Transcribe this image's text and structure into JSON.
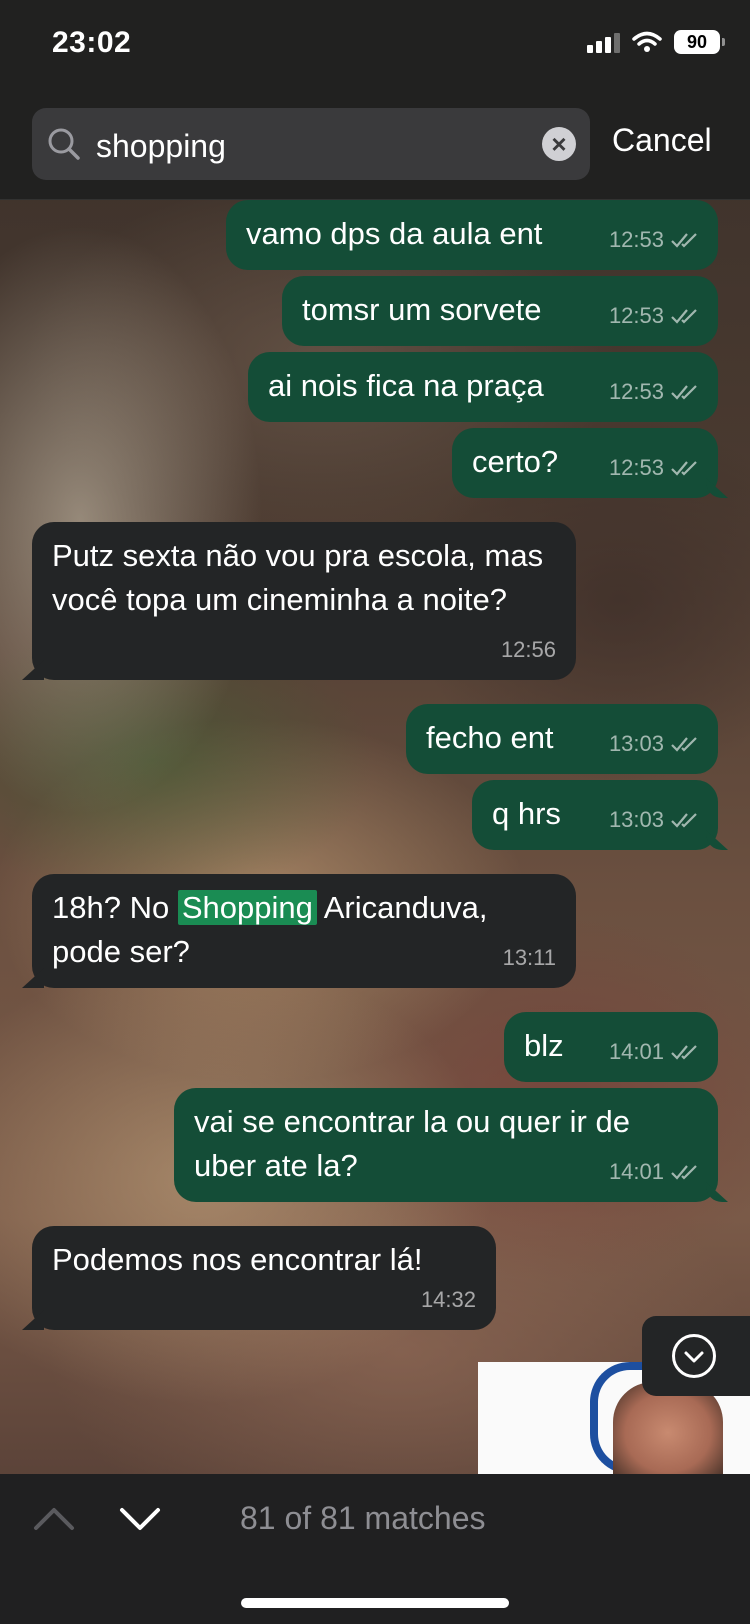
{
  "status_bar": {
    "time": "23:02",
    "battery": "90"
  },
  "search": {
    "query": "shopping",
    "cancel_label": "Cancel"
  },
  "messages": [
    {
      "dir": "out",
      "text": "vamo dps da aula ent",
      "time": "12:53"
    },
    {
      "dir": "out",
      "text": "tomsr um sorvete",
      "time": "12:53"
    },
    {
      "dir": "out",
      "text": "ai nois fica na praça",
      "time": "12:53"
    },
    {
      "dir": "out",
      "text": "certo?",
      "time": "12:53"
    },
    {
      "dir": "in",
      "text": "Putz sexta não vou pra escola, mas você topa um cineminha a noite?",
      "time": "12:56"
    },
    {
      "dir": "out",
      "text": "fecho ent",
      "time": "13:03"
    },
    {
      "dir": "out",
      "text": "q hrs",
      "time": "13:03"
    },
    {
      "dir": "in",
      "text_before": "18h? No ",
      "text_match": "Shopping",
      "text_after": " Aricanduva, pode ser?",
      "time": "13:11"
    },
    {
      "dir": "out",
      "text": "blz",
      "time": "14:01"
    },
    {
      "dir": "out",
      "text": "vai se encontrar la ou quer ir de uber ate la?",
      "time": "14:01"
    },
    {
      "dir": "in",
      "text": "Podemos nos encontrar lá!",
      "time": "14:32"
    }
  ],
  "footer": {
    "matches_text": "81 of 81 matches"
  },
  "colors": {
    "outgoing": "#144d37",
    "incoming": "#232526",
    "highlight": "#1a8c53"
  }
}
